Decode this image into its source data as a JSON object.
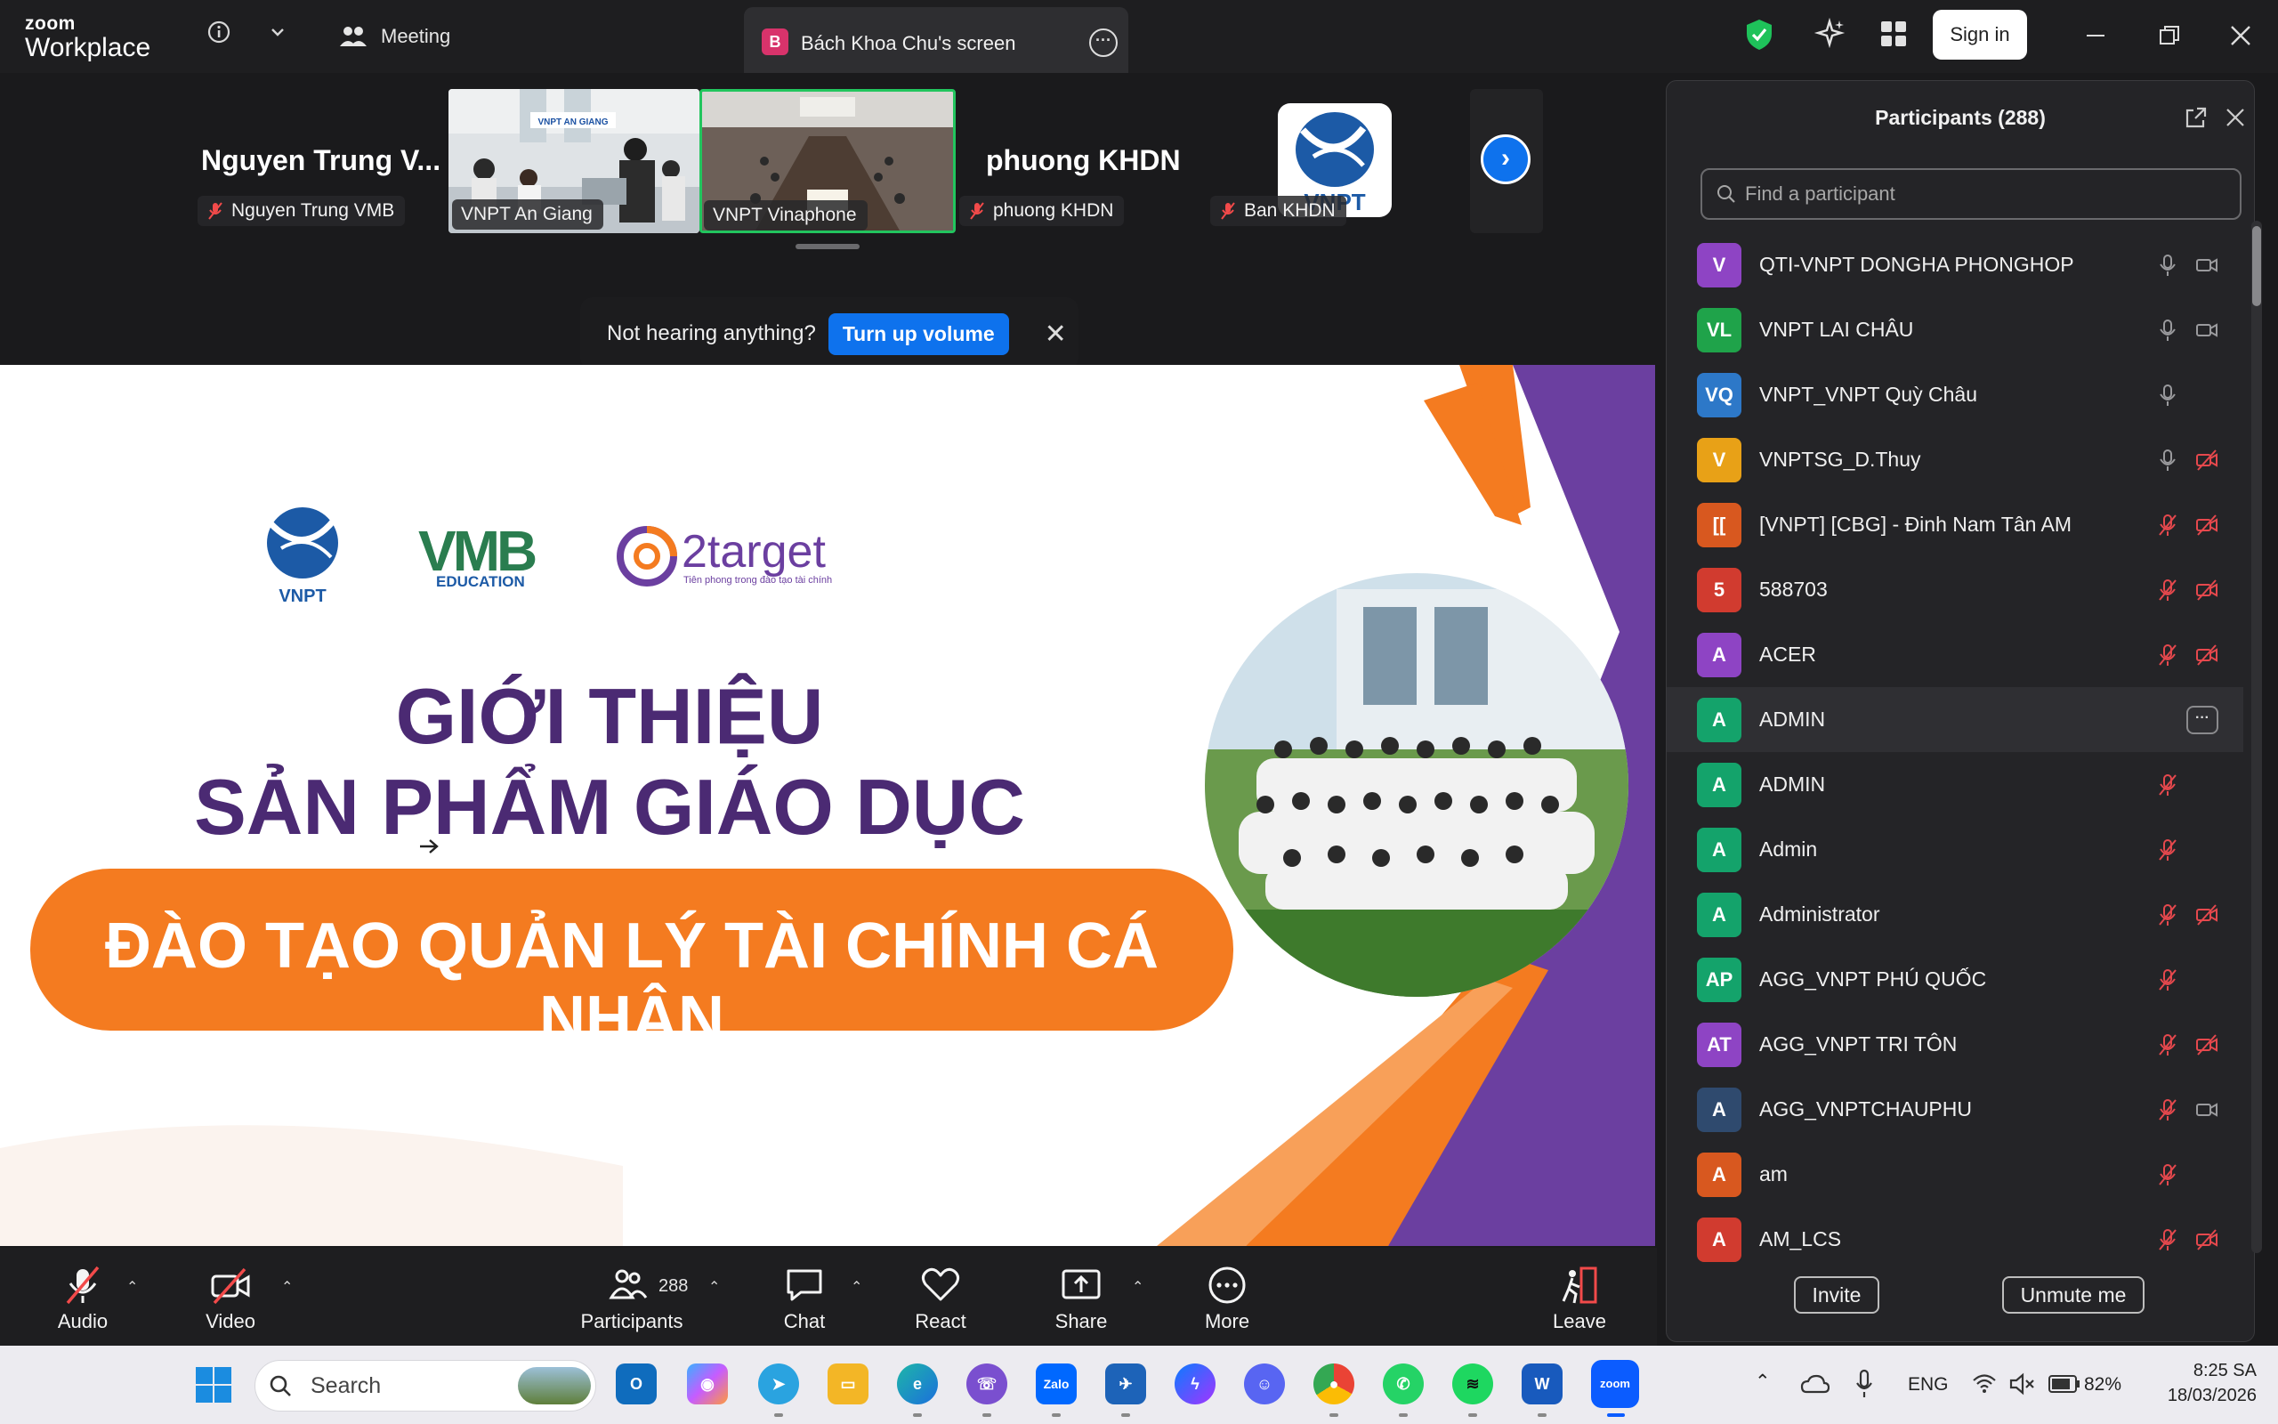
{
  "titlebar": {
    "brand_top": "zoom",
    "brand_bottom": "Workplace",
    "meeting_tab": "Meeting",
    "screen_tab": {
      "badge": "B",
      "label": "Bách Khoa Chu's screen"
    },
    "sign_in": "Sign in"
  },
  "filmstrip": {
    "tiles": [
      {
        "big_name": "Nguyen Trung V...",
        "label": "Nguyen Trung VMB",
        "muted": true
      },
      {
        "label": "VNPT An Giang",
        "muted": false
      },
      {
        "label": "VNPT Vinaphone",
        "muted": false,
        "active_speaker": true
      },
      {
        "big_name": "phuong KHDN",
        "label": "phuong KHDN",
        "muted": true
      },
      {
        "logo_text": "VNPT",
        "label": "Ban KHDN",
        "muted": true
      }
    ],
    "classroom_sign": "VNPT AN GIANG"
  },
  "notice": {
    "text": "Not hearing anything?",
    "button": "Turn up volume"
  },
  "slide": {
    "logos": {
      "vnpt": "VNPT",
      "vmb": "VMB",
      "vmb_sub": "EDUCATION",
      "target": "2target",
      "target_sub": "Tiên phong trong đào tạo tài chính"
    },
    "title_line1": "GIỚI THIỆU",
    "title_line2": "SẢN PHẨM GIÁO DỤC",
    "banner": "ĐÀO TẠO QUẢN LÝ TÀI CHÍNH CÁ NHÂN",
    "colors": {
      "purple": "#4b2a73",
      "orange": "#f47b20"
    }
  },
  "participants": {
    "title": "Participants (288)",
    "search_placeholder": "Find a participant",
    "list": [
      {
        "initials": "V",
        "name": "QTI-VNPT DONGHA PHONGHOP",
        "color": "#8e44c4",
        "mic": "on",
        "video": "on"
      },
      {
        "initials": "VL",
        "name": "VNPT LAI CHÂU",
        "color": "#1fa34a",
        "mic": "on",
        "video": "on"
      },
      {
        "initials": "VQ",
        "name": "VNPT_VNPT Quỳ Châu",
        "color": "#2d78c8",
        "mic": "on",
        "video": "none"
      },
      {
        "initials": "V",
        "name": "VNPTSG_D.Thuy",
        "color": "#e8a117",
        "mic": "on",
        "video": "off"
      },
      {
        "initials": "[[",
        "name": "[VNPT] [CBG] - Đinh Nam Tân AM",
        "color": "#d8581f",
        "mic": "off",
        "video": "off"
      },
      {
        "initials": "5",
        "name": "588703",
        "color": "#d13b2f",
        "mic": "off",
        "video": "off"
      },
      {
        "initials": "A",
        "name": "ACER",
        "color": "#8e44c4",
        "mic": "off",
        "video": "off"
      },
      {
        "initials": "A",
        "name": "ADMIN",
        "color": "#14a36b",
        "mic": "more",
        "video": "none"
      },
      {
        "initials": "A",
        "name": "ADMIN",
        "color": "#14a36b",
        "mic": "off",
        "video": "none"
      },
      {
        "initials": "A",
        "name": "Admin",
        "color": "#14a36b",
        "mic": "off",
        "video": "none"
      },
      {
        "initials": "A",
        "name": "Administrator",
        "color": "#14a36b",
        "mic": "off",
        "video": "off"
      },
      {
        "initials": "AP",
        "name": "AGG_VNPT PHÚ QUỐC",
        "color": "#14a36b",
        "mic": "off",
        "video": "none"
      },
      {
        "initials": "AT",
        "name": "AGG_VNPT TRI TÔN",
        "color": "#8e44c4",
        "mic": "off",
        "video": "off"
      },
      {
        "initials": "A",
        "name": "AGG_VNPTCHAUPHU",
        "color": "#2f4a6e",
        "mic": "off",
        "video": "on"
      },
      {
        "initials": "A",
        "name": "am",
        "color": "#d8581f",
        "mic": "off",
        "video": "none"
      },
      {
        "initials": "A",
        "name": "AM_LCS",
        "color": "#d13b2f",
        "mic": "off",
        "video": "off"
      }
    ],
    "invite": "Invite",
    "unmute_me": "Unmute me"
  },
  "toolbar": {
    "audio": "Audio",
    "video": "Video",
    "participants": "Participants",
    "participants_count": "288",
    "chat": "Chat",
    "react": "React",
    "share": "Share",
    "more": "More",
    "leave": "Leave"
  },
  "taskbar": {
    "search": "Search",
    "lang": "ENG",
    "battery": "82%",
    "time": "8:25 SA",
    "date": "18/03/2026"
  }
}
